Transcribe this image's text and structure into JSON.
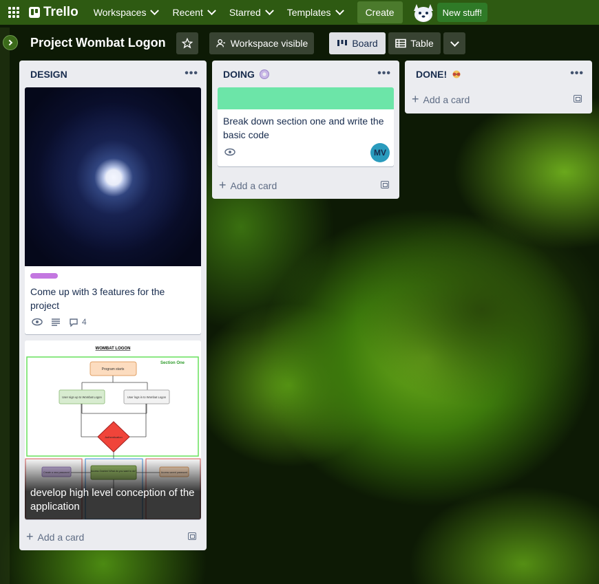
{
  "topbar": {
    "app_name": "Trello",
    "menus": [
      "Workspaces",
      "Recent",
      "Starred",
      "Templates"
    ],
    "create_label": "Create",
    "new_stuff_label": "New stuff!"
  },
  "board": {
    "title": "Project Wombat Logon",
    "visibility_label": "Workspace visible",
    "views": {
      "board": "Board",
      "table": "Table"
    }
  },
  "lists": [
    {
      "title": "DESIGN",
      "add_card": "Add a card",
      "cards": [
        {
          "title": "Come up with 3 features for the project",
          "label_color": "#c377e0",
          "comments": "4",
          "cover": "moon"
        },
        {
          "title": "develop high level conception of the application",
          "cover": "diagram",
          "diagram": {
            "heading": "WOMBAT LOGON",
            "section": "Section One",
            "nodes": [
              "Program starts",
              "User sign up to Wombat Logon",
              "User logs in to Wombat Logon",
              "Authentication",
              "Create a new password",
              "Access Granted What do you want to do?",
              "Access saved password"
            ]
          }
        }
      ]
    },
    {
      "title": "DOING",
      "title_icon": "gear-icon",
      "add_card": "Add a card",
      "cards": [
        {
          "title": "Break down section one and write the basic code",
          "cover_color": "#6ce5a8",
          "member_initials": "MV"
        }
      ]
    },
    {
      "title": "DONE!",
      "title_icon": "sunglasses-icon",
      "add_card": "Add a card",
      "cards": []
    }
  ],
  "colors": {
    "topbar": "#2e5a12",
    "list_bg": "#ebecf0",
    "avatar": "#2a9bbd",
    "new_stuff": "#2f7a27"
  }
}
